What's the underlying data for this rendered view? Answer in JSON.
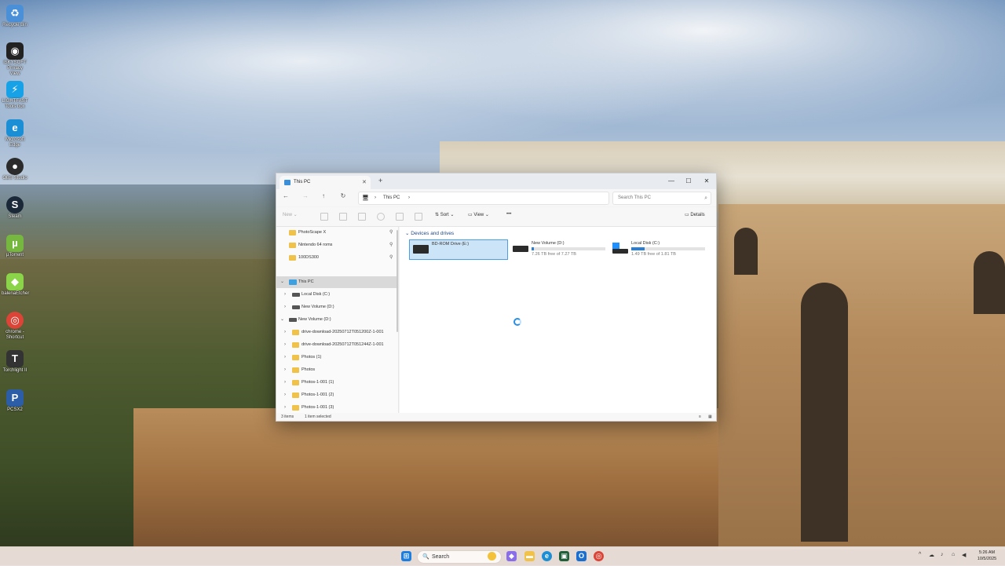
{
  "desktop": {
    "icons": [
      {
        "label": "Recycle Bin",
        "icon": "recycle-bin-icon",
        "glyph": "♻",
        "color": "#4a90d9"
      },
      {
        "label": "iSKYSOFT Privacy View",
        "icon": "eye-icon",
        "glyph": "◉",
        "color": "#222222"
      },
      {
        "label": "LIGHTFAST Tools box",
        "icon": "lightning-icon",
        "glyph": "⚡",
        "color": "#17a2e8"
      },
      {
        "label": "Microsoft Edge",
        "icon": "edge-icon",
        "glyph": "e",
        "color": "#1b8fd6"
      },
      {
        "label": "OBS Studio",
        "icon": "obs-icon",
        "glyph": "●",
        "color": "#2b2b2b"
      },
      {
        "label": "Steam",
        "icon": "steam-icon",
        "glyph": "S",
        "color": "#1b2838"
      },
      {
        "label": "µTorrent",
        "icon": "utorrent-icon",
        "glyph": "µ",
        "color": "#76b83f"
      },
      {
        "label": "balenaEtcher",
        "icon": "etcher-icon",
        "glyph": "◆",
        "color": "#8bd44a"
      },
      {
        "label": "chrome - Shortcut",
        "icon": "chrome-icon",
        "glyph": "◎",
        "color": "#db4437"
      },
      {
        "label": "Torchlight II",
        "icon": "torchlight-icon",
        "glyph": "T",
        "color": "#333333"
      },
      {
        "label": "PCSX2",
        "icon": "pcsx2-icon",
        "glyph": "P",
        "color": "#2c5ea8"
      }
    ]
  },
  "explorer": {
    "tab_title": "This PC",
    "new_tab": "+",
    "controls": {
      "minimize": "—",
      "maximize": "☐",
      "close": "✕"
    },
    "close_tab": "✕",
    "nav": {
      "back": "←",
      "forward": "→",
      "up": "↑",
      "refresh": "↻"
    },
    "breadcrumb": {
      "monitor": "🖥",
      "sep": "›",
      "location": "This PC",
      "sep2": "›"
    },
    "search_placeholder": "Search This PC",
    "toolbar": {
      "new": "New",
      "sort": "Sort",
      "view": "View",
      "more": "•••",
      "details": "Details"
    },
    "sidebar": {
      "pinned": [
        {
          "label": "PhotoScape X"
        },
        {
          "label": "Nintendo 64 roms"
        },
        {
          "label": "100DS300"
        }
      ],
      "this_pc": "This PC",
      "drives": [
        {
          "label": "Local Disk (C:)"
        },
        {
          "label": "New Volume (D:)"
        }
      ],
      "expanded_drive": "New Volume (D:)",
      "folders": [
        {
          "label": "drive-download-20250712T051200Z-1-001"
        },
        {
          "label": "drive-download-20250712T051244Z-1-001"
        },
        {
          "label": "Photos (1)"
        },
        {
          "label": "Photos"
        },
        {
          "label": "Photos-1-001 (1)"
        },
        {
          "label": "Photos-1-001 (2)"
        },
        {
          "label": "Photos-1-001 (3)"
        }
      ]
    },
    "group_header": "Devices and drives",
    "drives": [
      {
        "name": "BD-ROM Drive (E:)",
        "free": "",
        "used_fraction": 0
      },
      {
        "name": "New Volume (D:)",
        "free": "7.26 TB free of 7.27 TB",
        "used_fraction": 0.01
      },
      {
        "name": "Local Disk (C:)",
        "free": "1.49 TB free of 1.81 TB",
        "used_fraction": 0.18
      }
    ],
    "status": {
      "items": "3 items",
      "selected": "1 item selected"
    }
  },
  "taskbar": {
    "search_label": "Search",
    "search_icon": "🔍",
    "tray": {
      "up_arrow": "^",
      "time": "5:26 AM",
      "date": "10/5/2025"
    }
  }
}
